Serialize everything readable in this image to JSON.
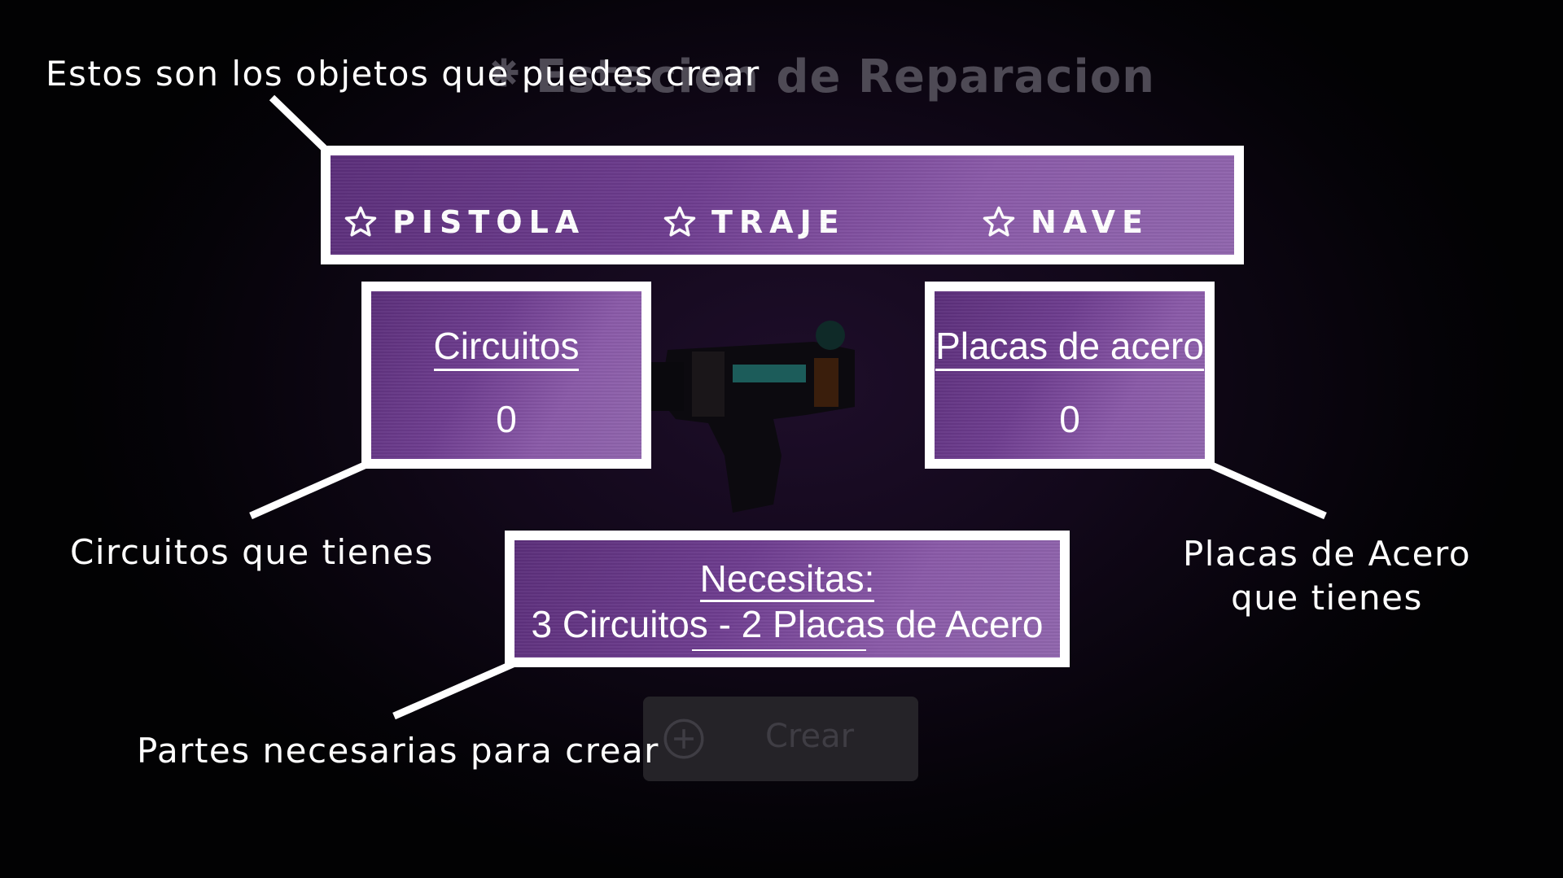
{
  "background_title": "Estacion de Reparacion",
  "tabs": [
    {
      "label": "PISTOLA",
      "icon": "star-icon"
    },
    {
      "label": "TRAJE",
      "icon": "star-icon"
    },
    {
      "label": "NAVE",
      "icon": "star-icon"
    }
  ],
  "resources": {
    "circuits": {
      "label": "Circuitos",
      "value": "0"
    },
    "plates": {
      "label": "Placas de acero",
      "value": "0"
    }
  },
  "needs": {
    "title": "Necesitas:",
    "text": "3 Circuitos - 2 Placas de Acero"
  },
  "create_button": {
    "label": "Crear",
    "icon": "plus-circle-icon"
  },
  "annotations": {
    "objects": "Estos son los objetos que puedes crear",
    "circuits": "Circuitos que tienes",
    "plates_line1": "Placas de Acero",
    "plates_line2": "que tienes",
    "parts": "Partes necesarias para crear"
  },
  "colors": {
    "panel": "#6e3d8f",
    "panel_border": "#ffffff",
    "background": "#0b0610"
  }
}
